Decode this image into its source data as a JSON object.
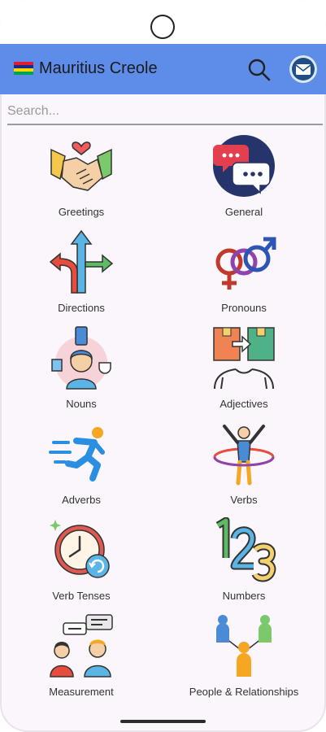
{
  "app": {
    "title": "Mauritius Creole",
    "flag_colors": [
      "#e21d32",
      "#1a2b8a",
      "#ffd500",
      "#00a551"
    ]
  },
  "status": {
    "time": "",
    "icons": ""
  },
  "appbar": {
    "search_icon": "search-icon",
    "mail_icon": "mail-icon",
    "color": "#5e8de9"
  },
  "search": {
    "placeholder": "Search...",
    "value": ""
  },
  "categories": [
    {
      "label": "Greetings",
      "icon": "handshake-heart-icon"
    },
    {
      "label": "General",
      "icon": "chat-bubbles-icon"
    },
    {
      "label": "Directions",
      "icon": "direction-arrows-icon"
    },
    {
      "label": "Pronouns",
      "icon": "gender-symbols-icon"
    },
    {
      "label": "Nouns",
      "icon": "person-objects-icon"
    },
    {
      "label": "Adjectives",
      "icon": "boxes-arrows-icon"
    },
    {
      "label": "Adverbs",
      "icon": "running-person-icon"
    },
    {
      "label": "Verbs",
      "icon": "hula-hoop-person-icon"
    },
    {
      "label": "Verb Tenses",
      "icon": "clock-icon"
    },
    {
      "label": "Numbers",
      "icon": "numbers-123-icon"
    },
    {
      "label": "Measurement",
      "icon": "people-talking-icon"
    },
    {
      "label": "People & Relationships",
      "icon": "people-network-icon"
    }
  ]
}
